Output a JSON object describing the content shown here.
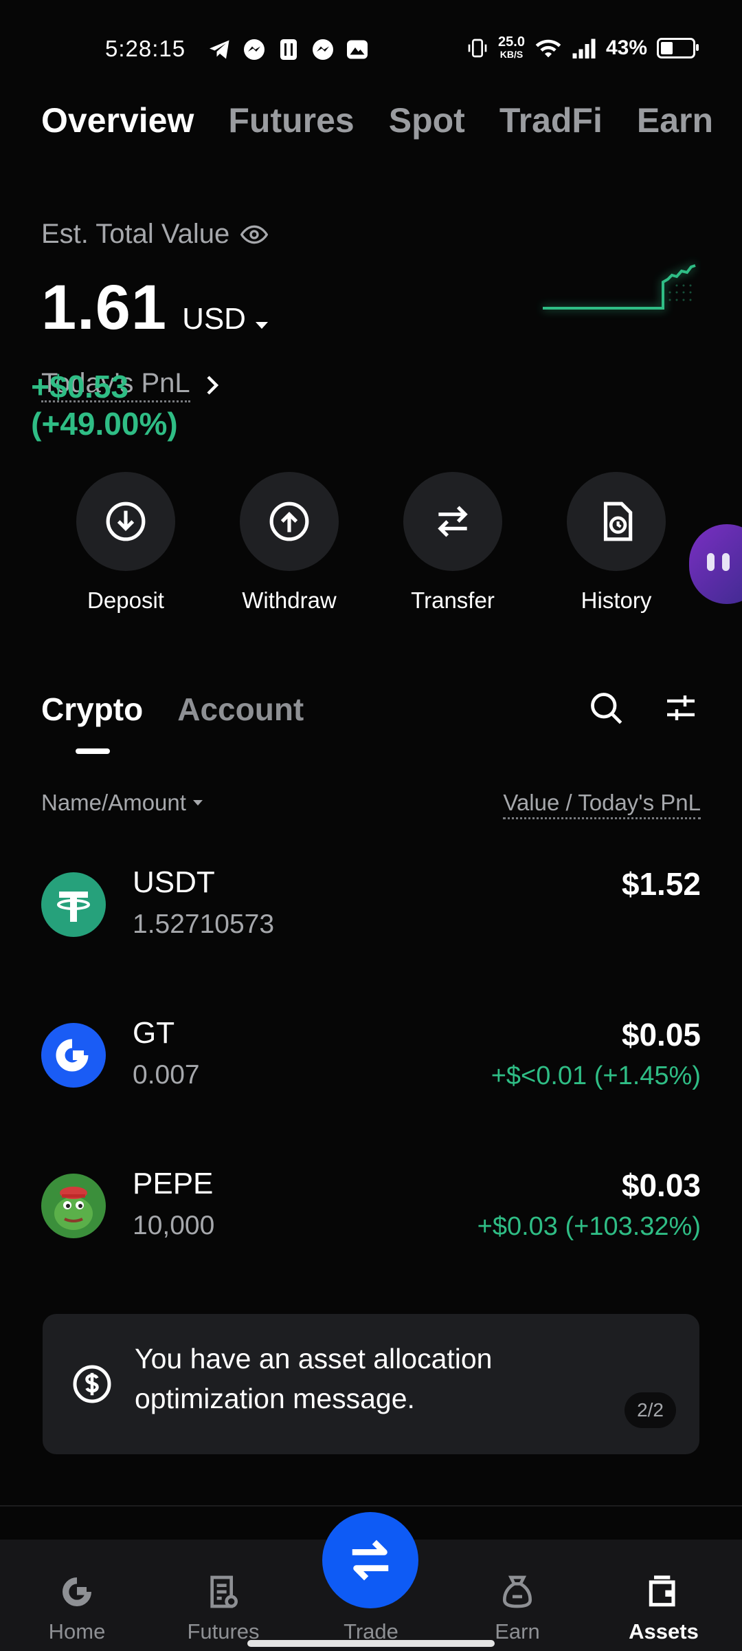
{
  "status_bar": {
    "time": "5:28:15",
    "net_speed": "25.0",
    "net_unit": "KB/S",
    "battery": "43%"
  },
  "top_tabs": [
    "Overview",
    "Futures",
    "Spot",
    "TradFi",
    "Earn"
  ],
  "overview": {
    "est_label": "Est. Total Value",
    "total_value": "1.61",
    "currency": "USD",
    "pnl_label": "Today's PnL",
    "pnl_value": "+$0.53 (+49.00%)"
  },
  "actions": [
    "Deposit",
    "Withdraw",
    "Transfer",
    "History"
  ],
  "sub_tabs": [
    "Crypto",
    "Account"
  ],
  "columns": {
    "left": "Name/Amount",
    "right": "Value / Today's PnL"
  },
  "assets": [
    {
      "symbol": "USDT",
      "amount": "1.52710573",
      "value": "$1.52",
      "pnl": ""
    },
    {
      "symbol": "GT",
      "amount": "0.007",
      "value": "$0.05",
      "pnl": "+$<0.01 (+1.45%)"
    },
    {
      "symbol": "PEPE",
      "amount": "10,000",
      "value": "$0.03",
      "pnl": "+$0.03 (+103.32%)"
    }
  ],
  "message": {
    "text": "You have an asset allocation optimization message.",
    "page": "2/2"
  },
  "bottom_nav": [
    "Home",
    "Futures",
    "Trade",
    "Earn",
    "Assets"
  ],
  "colors": {
    "positive": "#2fbd85",
    "brand_blue": "#0e5bf5",
    "background": "#060606"
  }
}
